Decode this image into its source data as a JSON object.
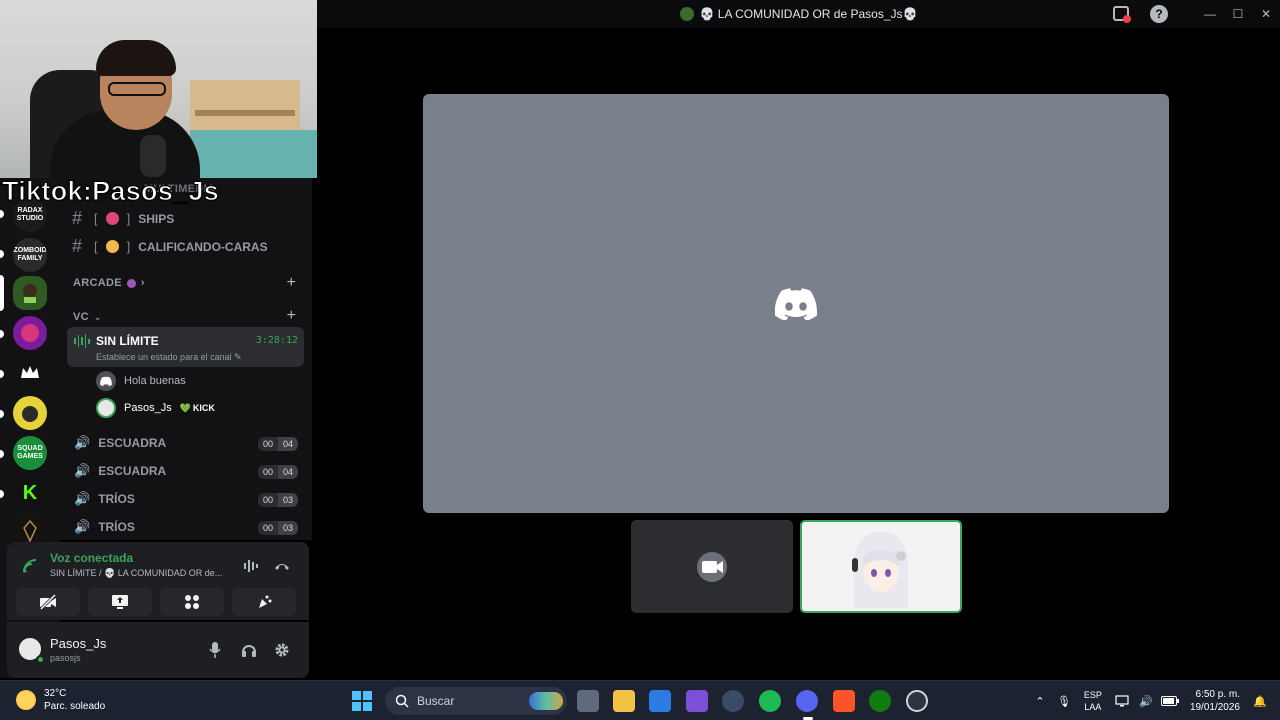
{
  "window": {
    "title": "💀 LA COMUNIDAD OR de Pasos_Js💀",
    "minimize": "—",
    "maximize": "☐",
    "close": "✕",
    "help": "?"
  },
  "overlay": {
    "tiktok_handle": "Tiktok:Pasos_Js"
  },
  "servers": [
    {
      "name": "RADAX STUDIO",
      "color": "#1b1b1b"
    },
    {
      "name": "ZOMBOID FAMILY",
      "color": "#2a2a2a"
    },
    {
      "name": "",
      "color": "#2f5a24"
    },
    {
      "name": "",
      "color": "#7a1c9c"
    },
    {
      "name": "",
      "color": "#111111"
    },
    {
      "name": "",
      "color": "#e6d23b"
    },
    {
      "name": "SQUAD GAMES",
      "color": "#1a8f3a"
    },
    {
      "name": "K",
      "color": "#111111"
    },
    {
      "name": "",
      "color": "#15130f"
    }
  ],
  "channels": {
    "partial_category": "MULTIMEDIA",
    "text": [
      {
        "label": "SHIPS",
        "prefix": "[",
        "suffix": "]"
      },
      {
        "label": "CALIFICANDO-CARAS",
        "prefix": "[",
        "suffix": "]"
      }
    ],
    "arcade_category": "ARCADE",
    "vc_category": "VC",
    "active_voice": {
      "name": "SIN LÍMITE",
      "status": "Establece un estado para el canal",
      "timer": "3:28:12",
      "members": [
        {
          "name": "Hola buenas"
        },
        {
          "name": "Pasos_Js",
          "badge": "KICK"
        }
      ]
    },
    "voice": [
      {
        "name": "ESCUADRA",
        "count": "00",
        "limit": "04"
      },
      {
        "name": "ESCUADRA",
        "count": "00",
        "limit": "04"
      },
      {
        "name": "TRÍOS",
        "count": "00",
        "limit": "03"
      },
      {
        "name": "TRÍOS",
        "count": "00",
        "limit": "03"
      }
    ]
  },
  "voice_panel": {
    "state": "Voz conectada",
    "location": "SIN LÍMITE / 💀 LA COMUNIDAD OR de..."
  },
  "user": {
    "name": "Pasos_Js",
    "tag": "pasosjs"
  },
  "taskbar": {
    "temperature": "32°C",
    "weather": "Parc. soleado",
    "search_placeholder": "Buscar",
    "lang_top": "ESP",
    "lang_bottom": "LAA",
    "time": "6:50 p. m.",
    "date": "19/01/2026"
  },
  "colors": {
    "accent_green": "#3ba55c",
    "stage_gray": "#7a7f8c",
    "discord_blurple": "#5865f2",
    "kick_green": "#53fc18"
  }
}
